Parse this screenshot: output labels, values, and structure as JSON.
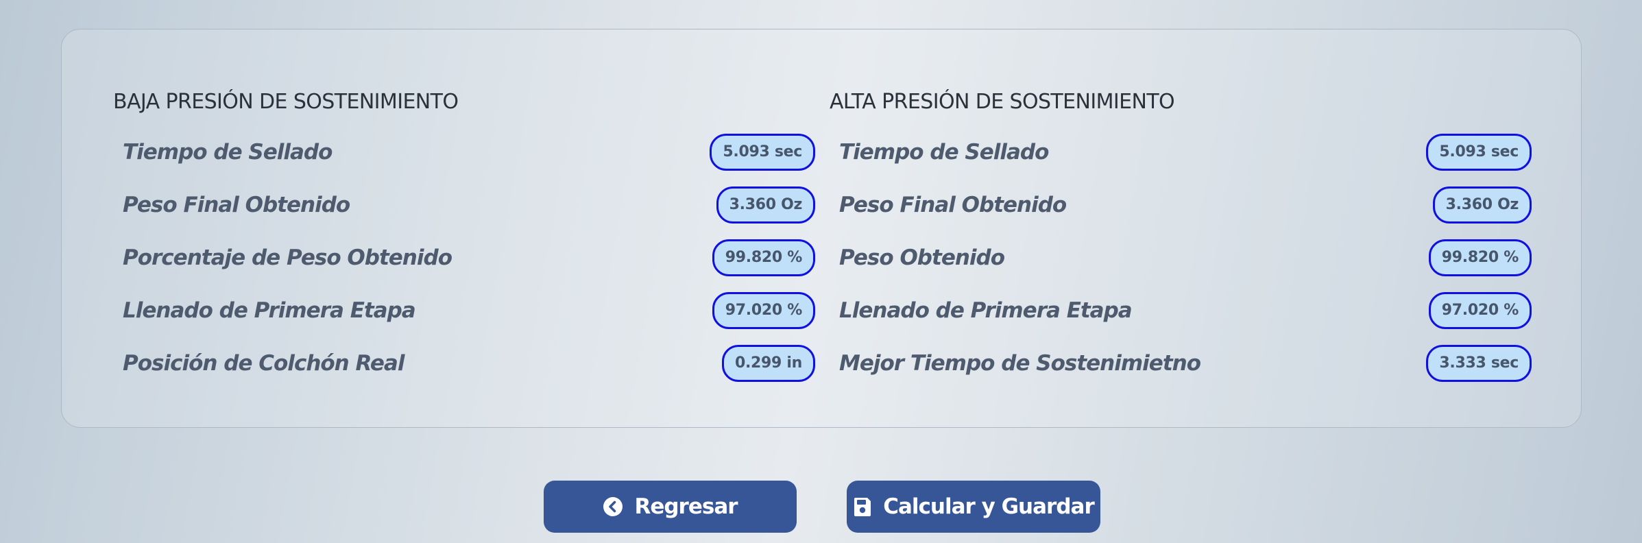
{
  "low_pressure": {
    "title": "BAJA PRESIÓN DE SOSTENIMIENTO",
    "rows": [
      {
        "label": "Tiempo de Sellado",
        "value": "5.093 sec"
      },
      {
        "label": "Peso Final Obtenido",
        "value": "3.360 Oz"
      },
      {
        "label": "Porcentaje de Peso Obtenido",
        "value": "99.820 %"
      },
      {
        "label": "Llenado de Primera Etapa",
        "value": "97.020 %"
      },
      {
        "label": "Posición de Colchón Real",
        "value": "0.299 in"
      }
    ]
  },
  "high_pressure": {
    "title": "ALTA PRESIÓN DE SOSTENIMIENTO",
    "rows": [
      {
        "label": "Tiempo de Sellado",
        "value": "5.093 sec"
      },
      {
        "label": "Peso Final Obtenido",
        "value": "3.360 Oz"
      },
      {
        "label": "Peso Obtenido",
        "value": "99.820 %"
      },
      {
        "label": "Llenado de Primera Etapa",
        "value": "97.020 %"
      },
      {
        "label": "Mejor Tiempo de Sostenimietno",
        "value": "3.333 sec"
      }
    ]
  },
  "actions": {
    "back_label": "Regresar",
    "back_icon": "chevron-left-circle-icon",
    "save_label": "Calcular y Guardar",
    "save_icon": "floppy-disk-icon"
  },
  "colors": {
    "accent": "#375697",
    "pill_border": "#1010e0",
    "pill_fill": "#bfe0f8",
    "label_text": "#4e5b6e"
  }
}
